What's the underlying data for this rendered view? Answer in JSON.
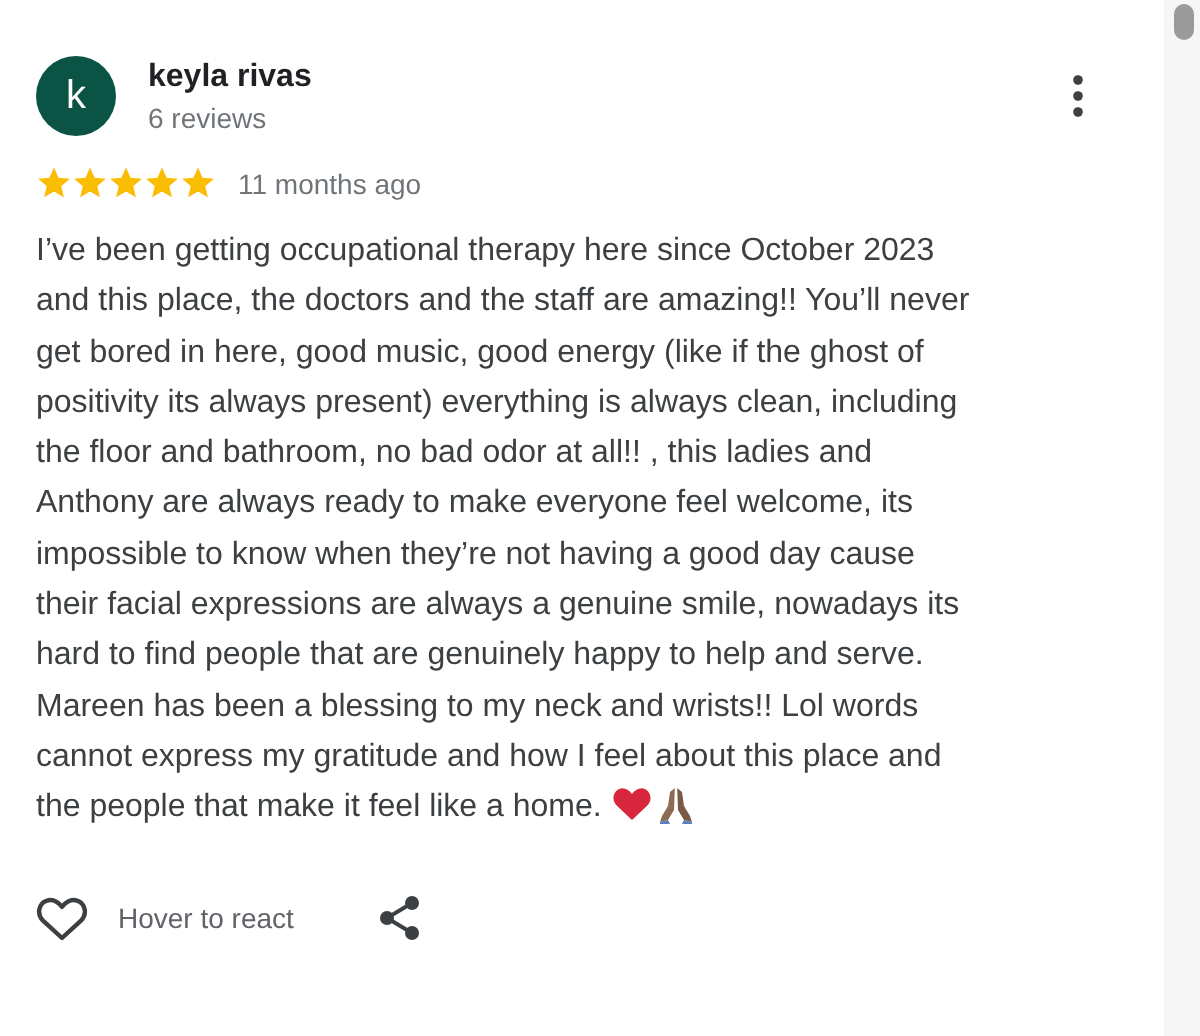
{
  "review": {
    "avatar_letter": "k",
    "author": "keyla rivas",
    "author_meta": "6 reviews",
    "stars": 5,
    "time": "11 months ago",
    "text": "I’ve been getting occupational therapy here since October 2023 and this place, the doctors and the staff are amazing!! You’ll never get bored in here, good music, good energy (like if the ghost of positivity its always present) everything is always clean, including the floor and bathroom, no bad odor at all!! , this ladies and Anthony are always ready to make everyone feel welcome, its impossible to know when they’re not having a good day cause their facial expressions are always a genuine smile, nowadays its hard to find people that are genuinely happy to help and serve. Mareen has been a blessing to my neck and wrists!! Lol words cannot express my gratitude and how I feel about this place and the people that make it feel like a home.",
    "react_label": "Hover to react"
  }
}
